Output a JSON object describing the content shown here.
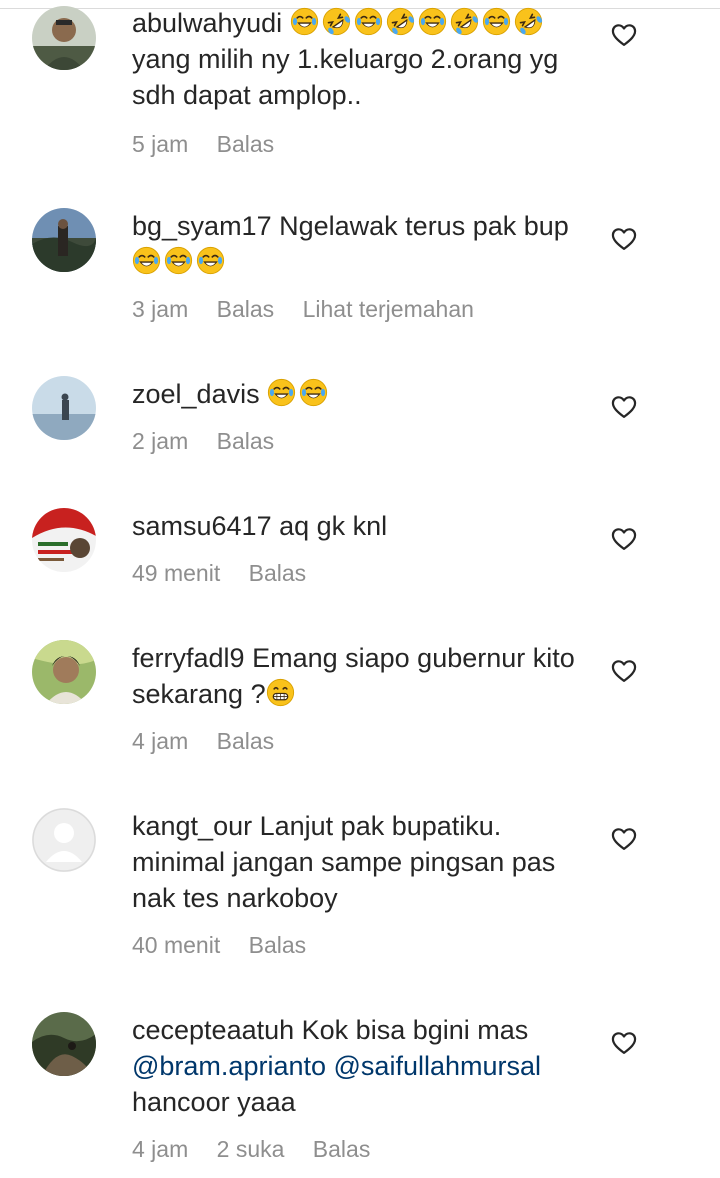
{
  "comments": [
    {
      "username": "abulwahyudi",
      "pre_emojis": [
        "laugh-tears",
        "rofl",
        "laugh-tears",
        "rofl",
        "laugh-tears",
        "rofl",
        "laugh-tears"
      ],
      "inline_emoji": "rofl",
      "text": "yang milih ny 1.keluargo 2.orang yg sdh dapat amplop..",
      "time": "5 jam",
      "reply": "Balas"
    },
    {
      "username": "bg_syam17",
      "text": "Ngelawak terus pak bup",
      "post_emojis": [
        "laugh-tears",
        "laugh-tears",
        "laugh-tears"
      ],
      "time": "3 jam",
      "reply": "Balas",
      "translate": "Lihat terjemahan"
    },
    {
      "username": "zoel_davis",
      "text": "",
      "post_emojis": [
        "laugh-tears",
        "laugh-tears"
      ],
      "time": "2 jam",
      "reply": "Balas"
    },
    {
      "username": "samsu6417",
      "text": "aq gk knl",
      "time": "49 menit",
      "reply": "Balas"
    },
    {
      "username": "ferryfadl9",
      "text": "Emang siapo gubernur kito sekarang ?",
      "post_emojis": [
        "grin"
      ],
      "time": "4 jam",
      "reply": "Balas"
    },
    {
      "username": "kangt_our",
      "text": "Lanjut pak bupatiku. minimal jangan sampe pingsan pas nak tes narkoboy",
      "time": "40 menit",
      "reply": "Balas"
    },
    {
      "username": "cecepteaatuh",
      "text": "Kok bisa bgini mas",
      "mention1": "@bram.aprianto",
      "mention2": "@saifullahmursal",
      "text_after": "hancoor yaaa",
      "time": "4 jam",
      "likes": "2 suka",
      "reply": "Balas"
    }
  ],
  "icons": {
    "like": "heart-outline-icon"
  },
  "colors": {
    "text": "#262626",
    "meta": "#8e8e8e",
    "mention": "#00376b",
    "background": "#ffffff"
  }
}
